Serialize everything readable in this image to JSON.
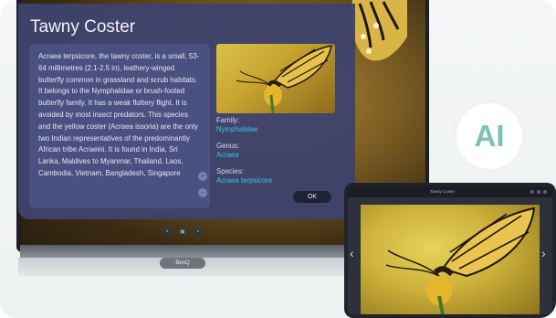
{
  "dialog": {
    "title": "Tawny Coster",
    "description": "Acraea terpsicore, the tawny coster, is a small, 53-64 millimetres (2.1-2.5 in), leathery-winged butterfly common in grassland and scrub habitats. It belongs to the Nymphalidae or brush-footed butterfly family. It has a weak fluttery flight. It is avoided by most insect predators. This species and the yellow coster (Acraea issoria) are the only two Indian representatives of the predominantly African tribe Acraeini. It is found in India, Sri Lanka, Maldives to Myanmar, Thailand, Laos, Cambodia, Vietnam, Bangladesh, Singapore",
    "family_label": "Family:",
    "family_value": "Nymphalidae",
    "genus_label": "Genus:",
    "genus_value": "Acraea",
    "species_label": "Species:",
    "species_value": "Acraea terpsicore",
    "ok_label": "OK",
    "scroll_up_icon": "+",
    "scroll_down_icon": "−"
  },
  "tv": {
    "base_label": "BenQ",
    "toolbar_icons": [
      "×",
      "▣",
      "×"
    ]
  },
  "badge": {
    "text": "AI",
    "color": "#7bc3b6"
  },
  "tablet": {
    "window_title": "Tawny Coster",
    "prev_icon": "‹",
    "next_icon": "›"
  },
  "colors": {
    "dialog_bg": "#3e436c",
    "link": "#3fc0ea"
  }
}
